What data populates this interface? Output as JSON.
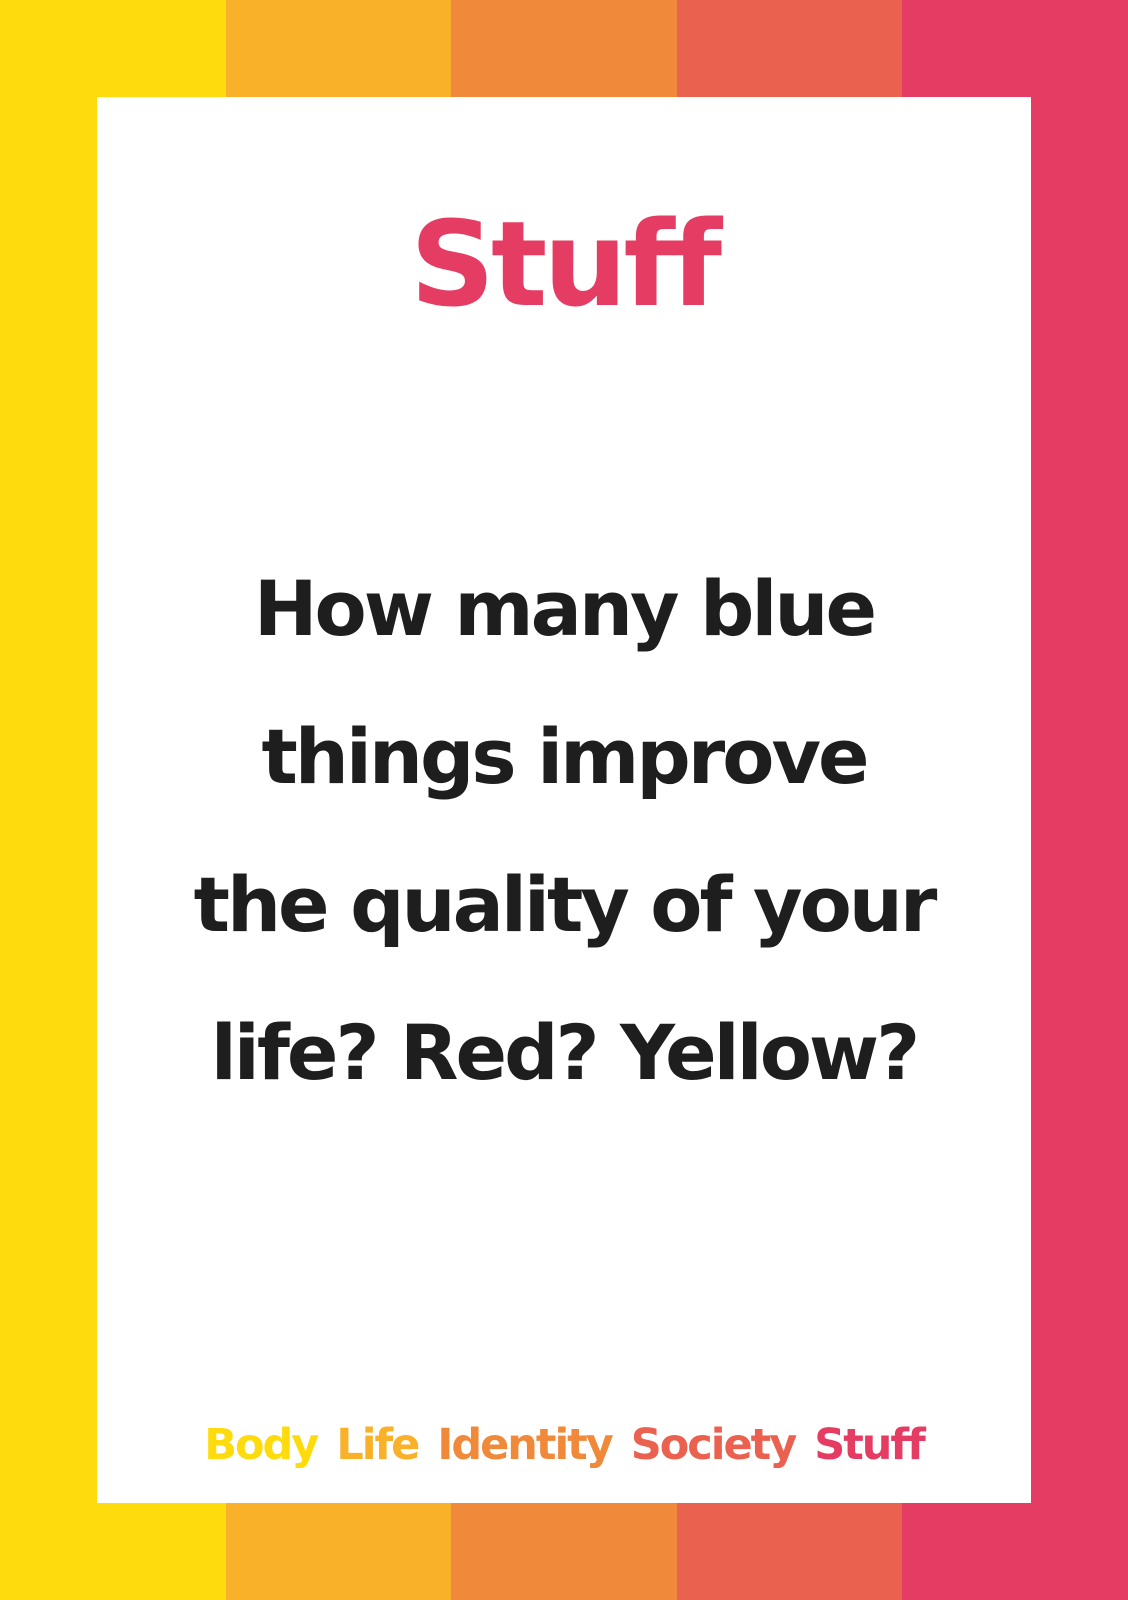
{
  "colors": {
    "stripes": [
      "#fddb0d",
      "#f8b129",
      "#f0893a",
      "#eb6150",
      "#e53c63"
    ],
    "title": "#e53c63",
    "question_text": "#1e1e1e",
    "card_background": "#ffffff"
  },
  "card": {
    "title": "Stuff",
    "question_lines": [
      "How many blue",
      "things improve",
      "the quality of your",
      "life? Red? Yellow?"
    ]
  },
  "categories": [
    {
      "label": "Body",
      "color": "#fddb0d"
    },
    {
      "label": "Life",
      "color": "#f8b129"
    },
    {
      "label": "Identity",
      "color": "#f0893a"
    },
    {
      "label": "Society",
      "color": "#eb6150"
    },
    {
      "label": "Stuff",
      "color": "#e53c63"
    }
  ]
}
